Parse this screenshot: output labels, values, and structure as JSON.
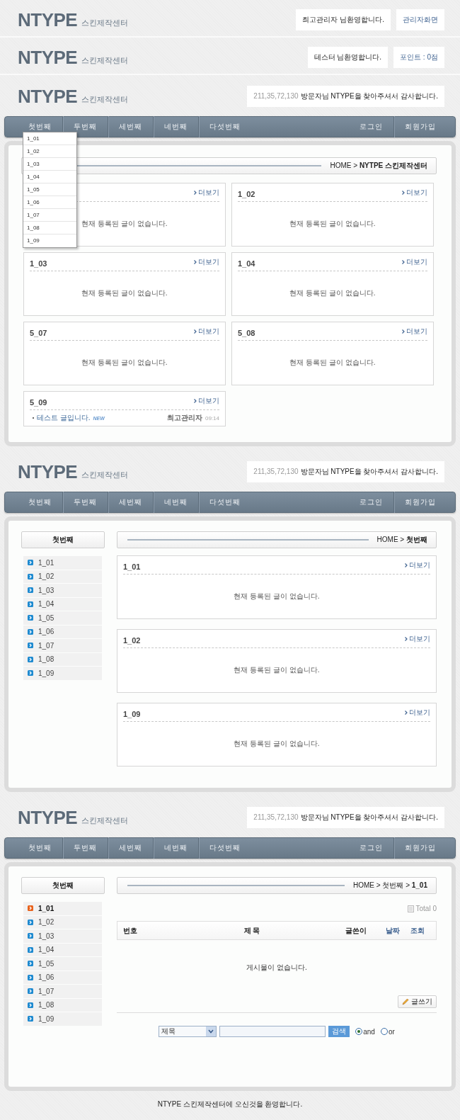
{
  "login_headers": [
    {
      "logo": "NTYPE",
      "subtitle": "스킨제작센터",
      "boxes": [
        {
          "text": "최고관리자 님환영합니다.",
          "kind": "text"
        },
        {
          "text": "관리자화면",
          "kind": "link"
        }
      ]
    },
    {
      "logo": "NTYPE",
      "subtitle": "스킨제작센터",
      "boxes": [
        {
          "text": "테스터 님환영합니다.",
          "kind": "text"
        },
        {
          "text": "포인트 : 0점",
          "kind": "link"
        }
      ]
    }
  ],
  "sections": [
    {
      "kind": "dashboard",
      "header": {
        "logo": "NTYPE",
        "subtitle": "스킨제작센터",
        "ip": "211,35,72,130",
        "message": "방문자님 NTYPE을 찾아주셔서 감사합니다."
      },
      "nav": {
        "menu": [
          {
            "label": "첫번째",
            "expanded": true,
            "dropdown": [
              "1_01",
              "1_02",
              "1_03",
              "1_04",
              "1_05",
              "1_06",
              "1_07",
              "1_08",
              "1_09"
            ]
          },
          {
            "label": "두번째"
          },
          {
            "label": "세번째"
          },
          {
            "label": "네번째"
          },
          {
            "label": "다섯번째"
          }
        ],
        "account": [
          "로그인",
          "회원가입"
        ]
      },
      "breadcrumb": "HOME > **NYTPE 스킨제작센터**",
      "cards": [
        {
          "more": "더보기",
          "empty": "현재 등록된 글이 없습니다."
        },
        {
          "title": "1_02",
          "more": "더보기",
          "empty": "현재 등록된 글이 없습니다."
        },
        {
          "title": "1_03",
          "more": "더보기",
          "empty": "현재 등록된 글이 없습니다."
        },
        {
          "title": "1_04",
          "more": "더보기",
          "empty": "현재 등록된 글이 없습니다."
        },
        {
          "title": "5_07",
          "more": "더보기",
          "empty": "현재 등록된 글이 없습니다."
        },
        {
          "title": "5_08",
          "more": "더보기",
          "empty": "현재 등록된 글이 없습니다."
        },
        {
          "title": "5_09",
          "more": "더보기",
          "posts": [
            {
              "title": "테스트 글입니다.",
              "badge": "NEW",
              "author": "최고관리자",
              "time": "09:14"
            }
          ]
        }
      ]
    },
    {
      "kind": "category",
      "header": {
        "logo": "NTYPE",
        "subtitle": "스킨제작센터",
        "ip": "211,35,72,130",
        "message": "방문자님 NTYPE을 찾아주셔서 감사합니다."
      },
      "nav": {
        "menu": [
          {
            "label": "첫번째"
          },
          {
            "label": "두번째"
          },
          {
            "label": "세번째"
          },
          {
            "label": "네번째"
          },
          {
            "label": "다섯번째"
          }
        ],
        "account": [
          "로그인",
          "회원가입"
        ]
      },
      "sidebar": {
        "title": "첫번째",
        "items": [
          {
            "label": "1_01",
            "selected": false
          },
          {
            "label": "1_02",
            "selected": false
          },
          {
            "label": "1_03",
            "selected": false
          },
          {
            "label": "1_04",
            "selected": false
          },
          {
            "label": "1_05",
            "selected": false
          },
          {
            "label": "1_06",
            "selected": false
          },
          {
            "label": "1_07",
            "selected": false
          },
          {
            "label": "1_08",
            "selected": false
          },
          {
            "label": "1_09",
            "selected": false
          }
        ]
      },
      "breadcrumb": "HOME > **첫번째**",
      "cards": [
        {
          "title": "1_01",
          "more": "더보기",
          "empty": "현재 등록된 글이 없습니다."
        },
        {
          "title": "1_02",
          "more": "더보기",
          "empty": "현재 등록된 글이 없습니다."
        },
        {
          "title": "1_09",
          "more": "더보기",
          "empty": "현재 등록된 글이 없습니다."
        }
      ]
    },
    {
      "kind": "board",
      "header": {
        "logo": "NTYPE",
        "subtitle": "스킨제작센터",
        "ip": "211,35,72,130",
        "message": "방문자님 NTYPE을 찾아주셔서 감사합니다."
      },
      "nav": {
        "menu": [
          {
            "label": "첫번째"
          },
          {
            "label": "두번째"
          },
          {
            "label": "세번째"
          },
          {
            "label": "네번째"
          },
          {
            "label": "다섯번째"
          }
        ],
        "account": [
          "로그인",
          "회원가입"
        ]
      },
      "sidebar": {
        "title": "첫번째",
        "items": [
          {
            "label": "1_01",
            "selected": true
          },
          {
            "label": "1_02",
            "selected": false
          },
          {
            "label": "1_03",
            "selected": false
          },
          {
            "label": "1_04",
            "selected": false
          },
          {
            "label": "1_05",
            "selected": false
          },
          {
            "label": "1_06",
            "selected": false
          },
          {
            "label": "1_07",
            "selected": false
          },
          {
            "label": "1_08",
            "selected": false
          },
          {
            "label": "1_09",
            "selected": false
          }
        ]
      },
      "breadcrumb": "HOME > 첫번째 > **1_01**",
      "board": {
        "total": "Total 0",
        "columns": [
          {
            "label": "번호",
            "kind": "text"
          },
          {
            "label": "제 목",
            "kind": "text"
          },
          {
            "label": "글쓴이",
            "kind": "text"
          },
          {
            "label": "날짜",
            "kind": "link"
          },
          {
            "label": "조회",
            "kind": "link"
          }
        ],
        "empty": "게시물이 없습니다.",
        "write_button": "글쓰기",
        "search": {
          "field": "제목",
          "button": "검색",
          "options": [
            {
              "label": "and",
              "selected": true
            },
            {
              "label": "or",
              "selected": false
            }
          ]
        }
      }
    }
  ],
  "footer": "NTYPE 스킨제작센터에 오신것을 환영합니다."
}
